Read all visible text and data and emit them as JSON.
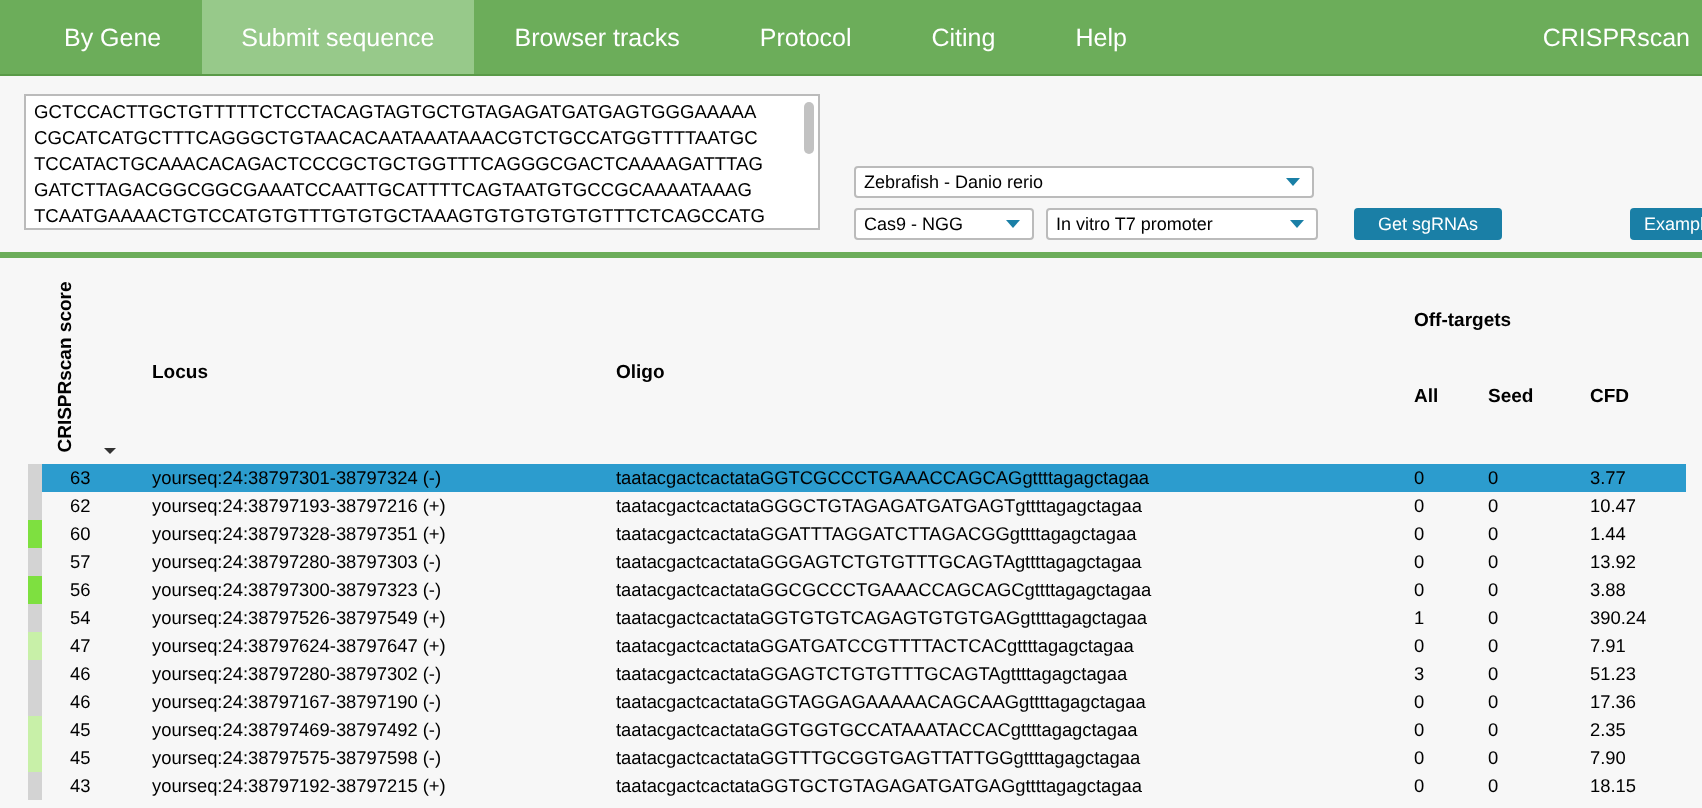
{
  "nav": {
    "tabs": [
      {
        "label": "By Gene",
        "selected": false
      },
      {
        "label": "Submit sequence",
        "selected": true
      },
      {
        "label": "Browser tracks",
        "selected": false
      },
      {
        "label": "Protocol",
        "selected": false
      },
      {
        "label": "Citing",
        "selected": false
      },
      {
        "label": "Help",
        "selected": false
      }
    ],
    "brand": "CRISPRscan"
  },
  "form": {
    "sequence_lines": [
      "GCTCCACTTGCTGTTTTTCTCCTACAGTAGTGCTGTAGAGATGATGAGTGGGAAAAA",
      "CGCATCATGCTTTCAGGGCTGTAACACAATAAATAAACGTCTGCCATGGTTTTAATGC",
      "TCCATACTGCAAACACAGACTCCCGCTGCTGGTTTCAGGGCGACTCAAAAGATTTAG",
      "GATCTTAGACGGCGGCGAAATCCAATTGCATTTTCAGTAATGTGCCGCAAAATAAAG",
      "TCAATGAAAACTGTCCATGTGTTTGTGTGCTAAAGTGTGTGTGTGTTTCTCAGCCATG"
    ],
    "species": "Zebrafish - Danio rerio",
    "enzyme": "Cas9 - NGG",
    "promoter": "In vitro T7 promoter",
    "buttons": [
      "Get sgRNAs",
      "Exampl"
    ]
  },
  "table": {
    "score_header": "CRISPRscan score",
    "locus_header": "Locus",
    "oligo_header": "Oligo",
    "group_header": "Off-targets",
    "all_header": "All",
    "seed_header": "Seed",
    "cfd_header": "CFD",
    "rows": [
      {
        "score": "63",
        "locus": "yourseq:24:38797301-38797324 (-)",
        "oligo": "taatacgactcactataGGTCGCCCTGAAACCAGCAGgttttagagctagaa",
        "all": "0",
        "seed": "0",
        "cfd": "3.77",
        "color": "#d3d3d3",
        "selected": true
      },
      {
        "score": "62",
        "locus": "yourseq:24:38797193-38797216 (+)",
        "oligo": "taatacgactcactataGGGCTGTAGAGATGATGAGTgttttagagctagaa",
        "all": "0",
        "seed": "0",
        "cfd": "10.47",
        "color": "#d3d3d3",
        "selected": false
      },
      {
        "score": "60",
        "locus": "yourseq:24:38797328-38797351 (+)",
        "oligo": "taatacgactcactataGGATTTAGGATCTTAGACGGgttttagagctagaa",
        "all": "0",
        "seed": "0",
        "cfd": "1.44",
        "color": "#7ee040",
        "selected": false
      },
      {
        "score": "57",
        "locus": "yourseq:24:38797280-38797303 (-)",
        "oligo": "taatacgactcactataGGGAGTCTGTGTTTGCAGTAgttttagagctagaa",
        "all": "0",
        "seed": "0",
        "cfd": "13.92",
        "color": "#d3d3d3",
        "selected": false
      },
      {
        "score": "56",
        "locus": "yourseq:24:38797300-38797323 (-)",
        "oligo": "taatacgactcactataGGCGCCCTGAAACCAGCAGCgttttagagctagaa",
        "all": "0",
        "seed": "0",
        "cfd": "3.88",
        "color": "#7ee040",
        "selected": false
      },
      {
        "score": "54",
        "locus": "yourseq:24:38797526-38797549 (+)",
        "oligo": "taatacgactcactataGGTGTGTCAGAGTGTGTGAGgttttagagctagaa",
        "all": "1",
        "seed": "0",
        "cfd": "390.24",
        "color": "#d3d3d3",
        "selected": false
      },
      {
        "score": "47",
        "locus": "yourseq:24:38797624-38797647 (+)",
        "oligo": "taatacgactcactataGGATGATCCGTTTTACTCACgttttagagctagaa",
        "all": "0",
        "seed": "0",
        "cfd": "7.91",
        "color": "#c8f0a8",
        "selected": false
      },
      {
        "score": "46",
        "locus": "yourseq:24:38797280-38797302 (-)",
        "oligo": "taatacgactcactataGGAGTCTGTGTTTGCAGTAgttttagagctagaa",
        "all": "3",
        "seed": "0",
        "cfd": "51.23",
        "color": "#d3d3d3",
        "selected": false
      },
      {
        "score": "46",
        "locus": "yourseq:24:38797167-38797190 (-)",
        "oligo": "taatacgactcactataGGTAGGAGAAAAACAGCAAGgttttagagctagaa",
        "all": "0",
        "seed": "0",
        "cfd": "17.36",
        "color": "#d3d3d3",
        "selected": false
      },
      {
        "score": "45",
        "locus": "yourseq:24:38797469-38797492 (-)",
        "oligo": "taatacgactcactataGGTGGTGCCATAAATACCACgttttagagctagaa",
        "all": "0",
        "seed": "0",
        "cfd": "2.35",
        "color": "#c8f0a8",
        "selected": false
      },
      {
        "score": "45",
        "locus": "yourseq:24:38797575-38797598 (-)",
        "oligo": "taatacgactcactataGGTTTGCGGTGAGTTATTGGgttttagagctagaa",
        "all": "0",
        "seed": "0",
        "cfd": "7.90",
        "color": "#c8f0a8",
        "selected": false
      },
      {
        "score": "43",
        "locus": "yourseq:24:38797192-38797215 (+)",
        "oligo": "taatacgactcactataGGTGCTGTAGAGATGATGAGgttttagagctagaa",
        "all": "0",
        "seed": "0",
        "cfd": "18.15",
        "color": "#d3d3d3",
        "selected": false
      }
    ]
  }
}
